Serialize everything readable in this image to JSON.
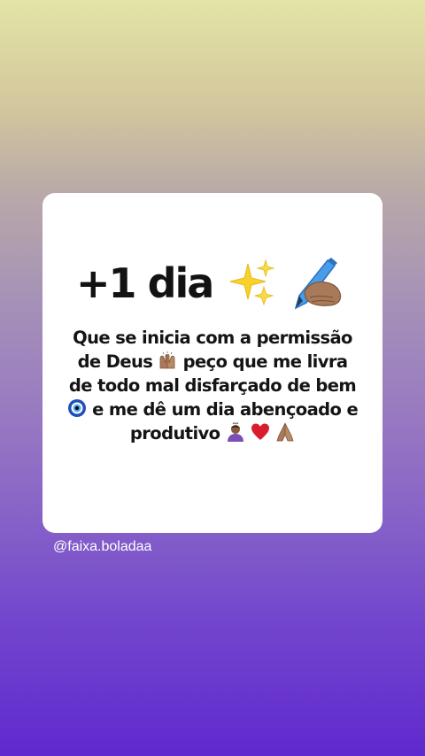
{
  "card": {
    "headline": "+1 dia",
    "headline_icons": [
      "sparkles-icon",
      "writing-hand-icon"
    ],
    "message": {
      "line1": "Que se inicia com a permissão",
      "line2a": "de Deus",
      "line2b": "peço que me livra",
      "line3": "de todo mal disfarçado de bem",
      "line4": "e me dê um dia abençoado e",
      "line5": "produtivo"
    },
    "inline_icons": [
      "raised-hands-icon",
      "nazar-amulet-icon",
      "person-bowing-icon",
      "red-heart-icon",
      "folded-hands-icon"
    ]
  },
  "credit": {
    "handle": "@faixa.boladaa"
  },
  "colors": {
    "gradient_top": "#e3e4a6",
    "gradient_bottom": "#5f29cf",
    "card_bg": "#ffffff",
    "text": "#141414",
    "sparkle": "#f6d22b",
    "pen": "#4a9be8",
    "skin": "#a97a5a",
    "heart": "#d81e2c",
    "nazar": "#1f4fb8"
  }
}
